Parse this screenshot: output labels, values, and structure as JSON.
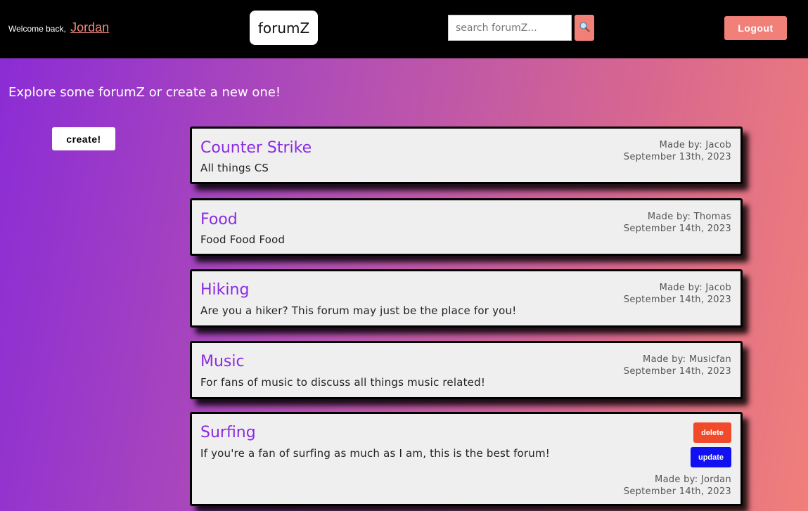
{
  "header": {
    "welcome_text": "Welcome back,",
    "username": "Jordan",
    "logo": "forumZ",
    "search_placeholder": "search forumZ...",
    "search_icon": "magnifier-icon",
    "logout_label": "Logout"
  },
  "main": {
    "headline": "Explore some forumZ or create a new one!",
    "create_label": "create!"
  },
  "forums": [
    {
      "title": "Counter Strike",
      "description": "All things CS",
      "author": "Made by: Jacob",
      "date": "September 13th, 2023"
    },
    {
      "title": "Food",
      "description": "Food Food Food",
      "author": "Made by: Thomas",
      "date": "September 14th, 2023"
    },
    {
      "title": "Hiking",
      "description": "Are you a hiker? This forum may just be the place for you!",
      "author": "Made by: Jacob",
      "date": "September 14th, 2023"
    },
    {
      "title": "Music",
      "description": "For fans of music to discuss all things music related!",
      "author": "Made by: Musicfan",
      "date": "September 14th, 2023"
    },
    {
      "title": "Surfing",
      "description": "If you're a fan of surfing as much as I am, this is the best forum!",
      "author": "Made by: Jordan",
      "date": "September 14th, 2023",
      "delete_label": "delete",
      "update_label": "update"
    }
  ],
  "colors": {
    "accent": "#f08078",
    "title": "#8a2be2",
    "delete": "#f04a2a",
    "update": "#1010f0"
  }
}
